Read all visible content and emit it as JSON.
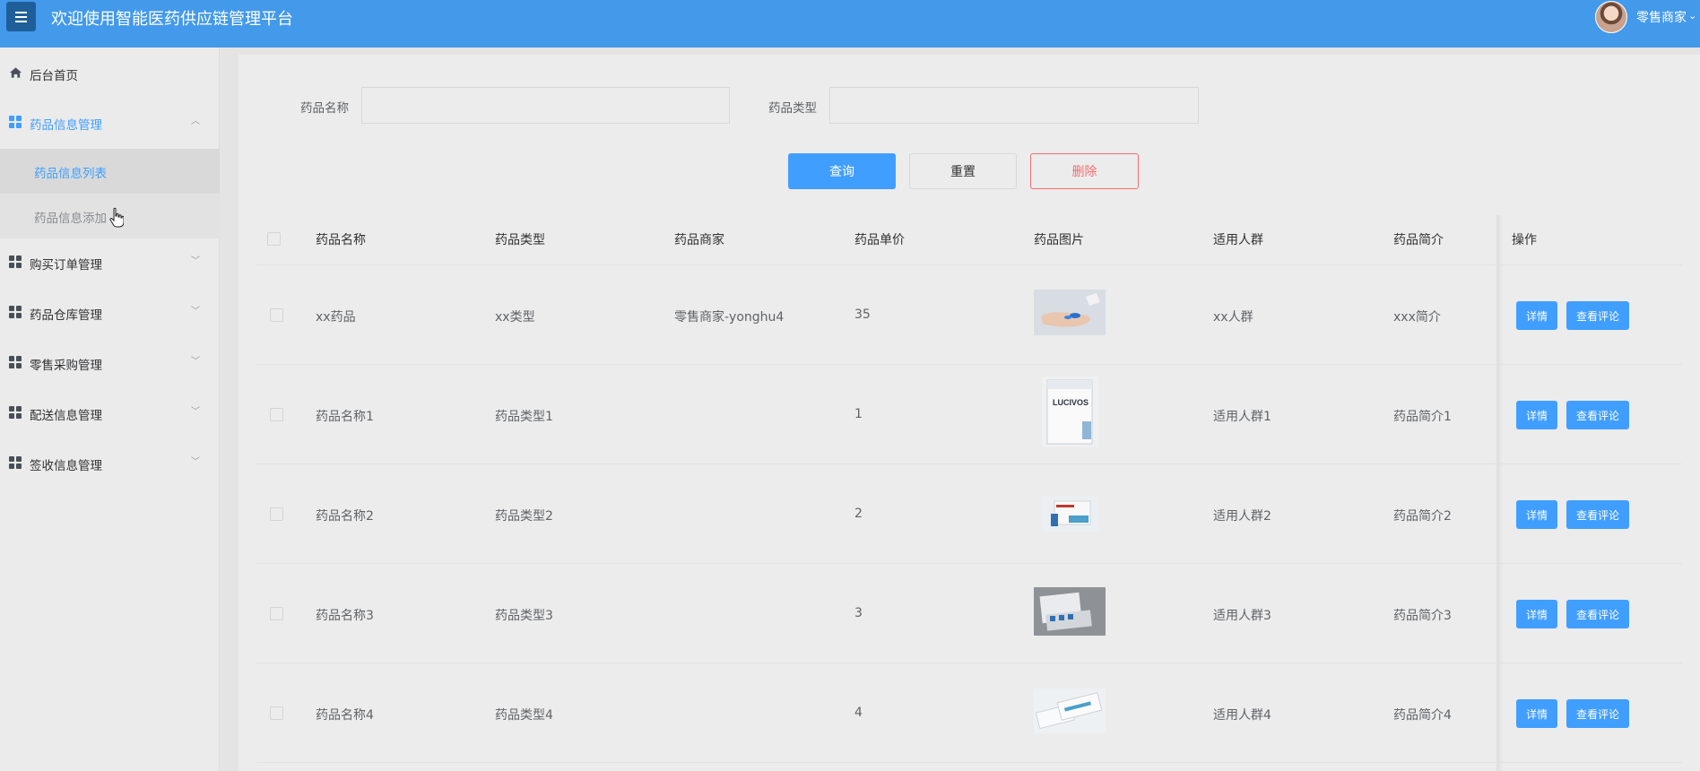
{
  "header": {
    "title": "欢迎使用智能医药供应链管理平台",
    "user_name": "零售商家",
    "user_caret": "⌄",
    "menu_icon": "hamburger-icon"
  },
  "sidebar": {
    "home": "后台首页",
    "groups": [
      {
        "label": "药品信息管理",
        "expanded": true,
        "children": [
          "药品信息列表",
          "药品信息添加"
        ]
      },
      {
        "label": "购买订单管理"
      },
      {
        "label": "药品仓库管理"
      },
      {
        "label": "零售采购管理"
      },
      {
        "label": "配送信息管理"
      },
      {
        "label": "签收信息管理"
      }
    ],
    "chev_up": "︿",
    "chev_down": "﹀"
  },
  "search": {
    "name_label": "药品名称",
    "name_value": "",
    "type_label": "药品类型",
    "type_value": "",
    "query_btn": "查询",
    "reset_btn": "重置",
    "delete_btn": "删除"
  },
  "table": {
    "columns": [
      "药品名称",
      "药品类型",
      "药品商家",
      "药品单价",
      "药品图片",
      "适用人群",
      "药品简介",
      "操作"
    ],
    "rows": [
      {
        "name": "xx药品",
        "type": "xx类型",
        "merchant": "零售商家-yonghu4",
        "price": "35",
        "crowd": "xx人群",
        "intro": "xxx简介"
      },
      {
        "name": "药品名称1",
        "type": "药品类型1",
        "merchant": "",
        "price": "1",
        "crowd": "适用人群1",
        "intro": "药品简介1"
      },
      {
        "name": "药品名称2",
        "type": "药品类型2",
        "merchant": "",
        "price": "2",
        "crowd": "适用人群2",
        "intro": "药品简介2"
      },
      {
        "name": "药品名称3",
        "type": "药品类型3",
        "merchant": "",
        "price": "3",
        "crowd": "适用人群3",
        "intro": "药品简介3"
      },
      {
        "name": "药品名称4",
        "type": "药品类型4",
        "merchant": "",
        "price": "4",
        "crowd": "适用人群4",
        "intro": "药品简介4"
      }
    ],
    "detail_btn": "详情",
    "review_btn": "查看评论",
    "image_text": "LUCIVOS"
  },
  "colors": {
    "header_bg": "#4399ea",
    "primary": "#409eff",
    "danger": "#f56c6c"
  }
}
